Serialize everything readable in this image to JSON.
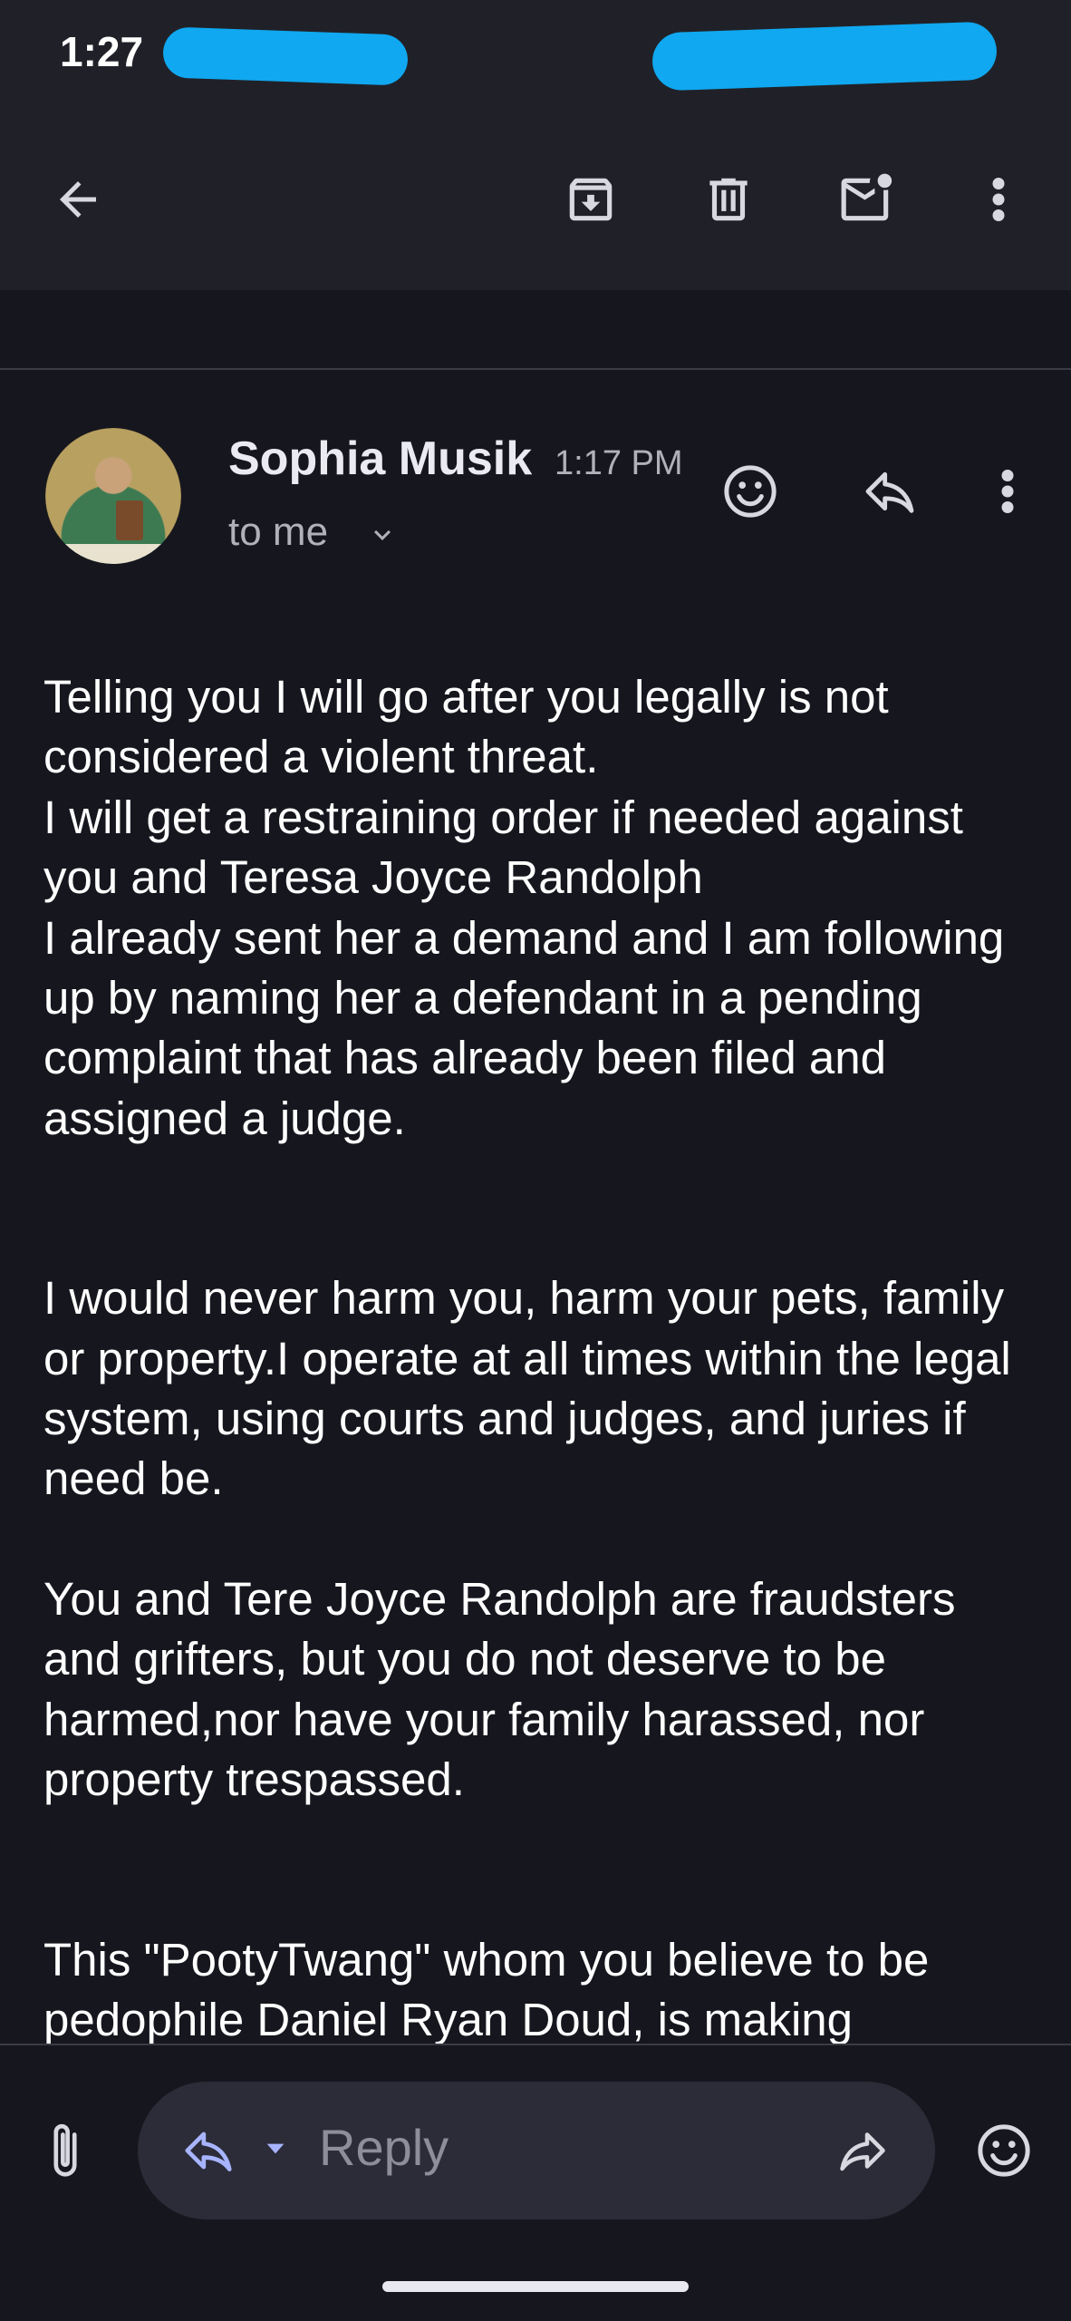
{
  "status_bar": {
    "time": "1:27"
  },
  "toolbar": {
    "icons": [
      "back-arrow-icon",
      "archive-icon",
      "delete-icon",
      "mark-unread-icon",
      "more-vert-icon"
    ]
  },
  "message": {
    "sender": "Sophia Musik",
    "time": "1:17 PM",
    "recipient_label": "to me",
    "paragraphs": [
      "Telling you I will go after you legally is not considered a violent threat.\nI will get a restraining order if needed against you and Teresa Joyce Randolph\nI already sent her a demand and I am following up by naming her a defendant in a pending complaint that has already been filed and assigned a judge.",
      "I would never harm you, harm your pets, family or property.I operate at all times within the legal system, using courts and judges, and juries if need be.",
      "You and Tere Joyce Randolph are fraudsters and grifters, but you do not deserve to be harmed,nor have your family harassed, nor property trespassed.",
      "This \"PootyTwang\" whom you believe to be pedophile Daniel Ryan Doud, is making"
    ]
  },
  "compose_bar": {
    "reply_placeholder": "Reply"
  },
  "colors": {
    "background": "#16161e",
    "appbar": "#202128",
    "reply_pill": "#2b2c38",
    "accent_reply_icon": "#a8b4ff"
  }
}
